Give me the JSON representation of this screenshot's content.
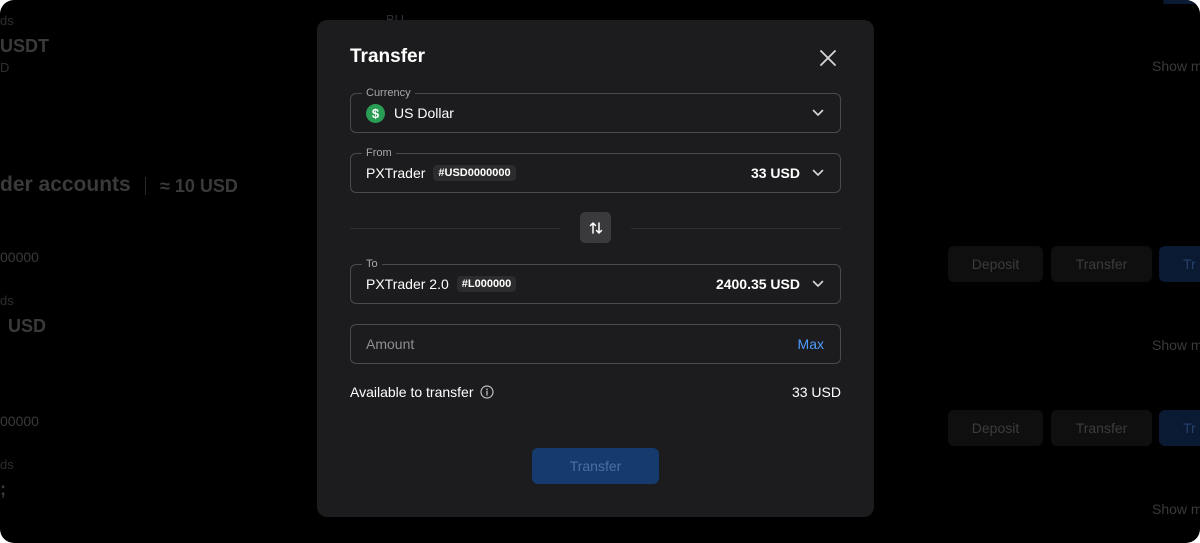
{
  "background": {
    "top_label": "BU",
    "ds1": "ds",
    "currency1": "USDT",
    "d1": "D",
    "show_more_1": "Show m",
    "section_title": "der accounts",
    "section_total": "≈ 10 USD",
    "account1_id": "00000",
    "ds2": "ds",
    "balance2": "USD",
    "show_more_2": "Show m",
    "account2_id": "00000",
    "ds3": "ds",
    "balance3": ";",
    "show_more_3": "Show m",
    "row1": {
      "deposit": "Deposit",
      "transfer": "Transfer",
      "trade": "Tr"
    },
    "row2": {
      "deposit": "Deposit",
      "transfer": "Transfer",
      "trade": "Tr"
    }
  },
  "modal": {
    "title": "Transfer",
    "currency": {
      "label": "Currency",
      "icon_glyph": "$",
      "value": "US Dollar"
    },
    "from": {
      "label": "From",
      "account": "PXTrader",
      "tag": "#USD0000000",
      "amount": "33 USD"
    },
    "to": {
      "label": "To",
      "account": "PXTrader 2.0",
      "tag": "#L000000",
      "amount": "2400.35 USD"
    },
    "amount": {
      "placeholder": "Amount",
      "max_label": "Max"
    },
    "available": {
      "label": "Available to transfer",
      "value": "33 USD"
    },
    "submit_label": "Transfer"
  },
  "colors": {
    "accent": "#4e9bff",
    "currency_badge": "#2a9d54",
    "modal_bg": "#1c1c1e",
    "submit_bg": "#153a6e"
  },
  "icons": {
    "close": "close-icon",
    "chevron": "chevron-down-icon",
    "swap": "swap-vertical-icon",
    "info": "info-icon",
    "currency": "dollar-icon"
  }
}
